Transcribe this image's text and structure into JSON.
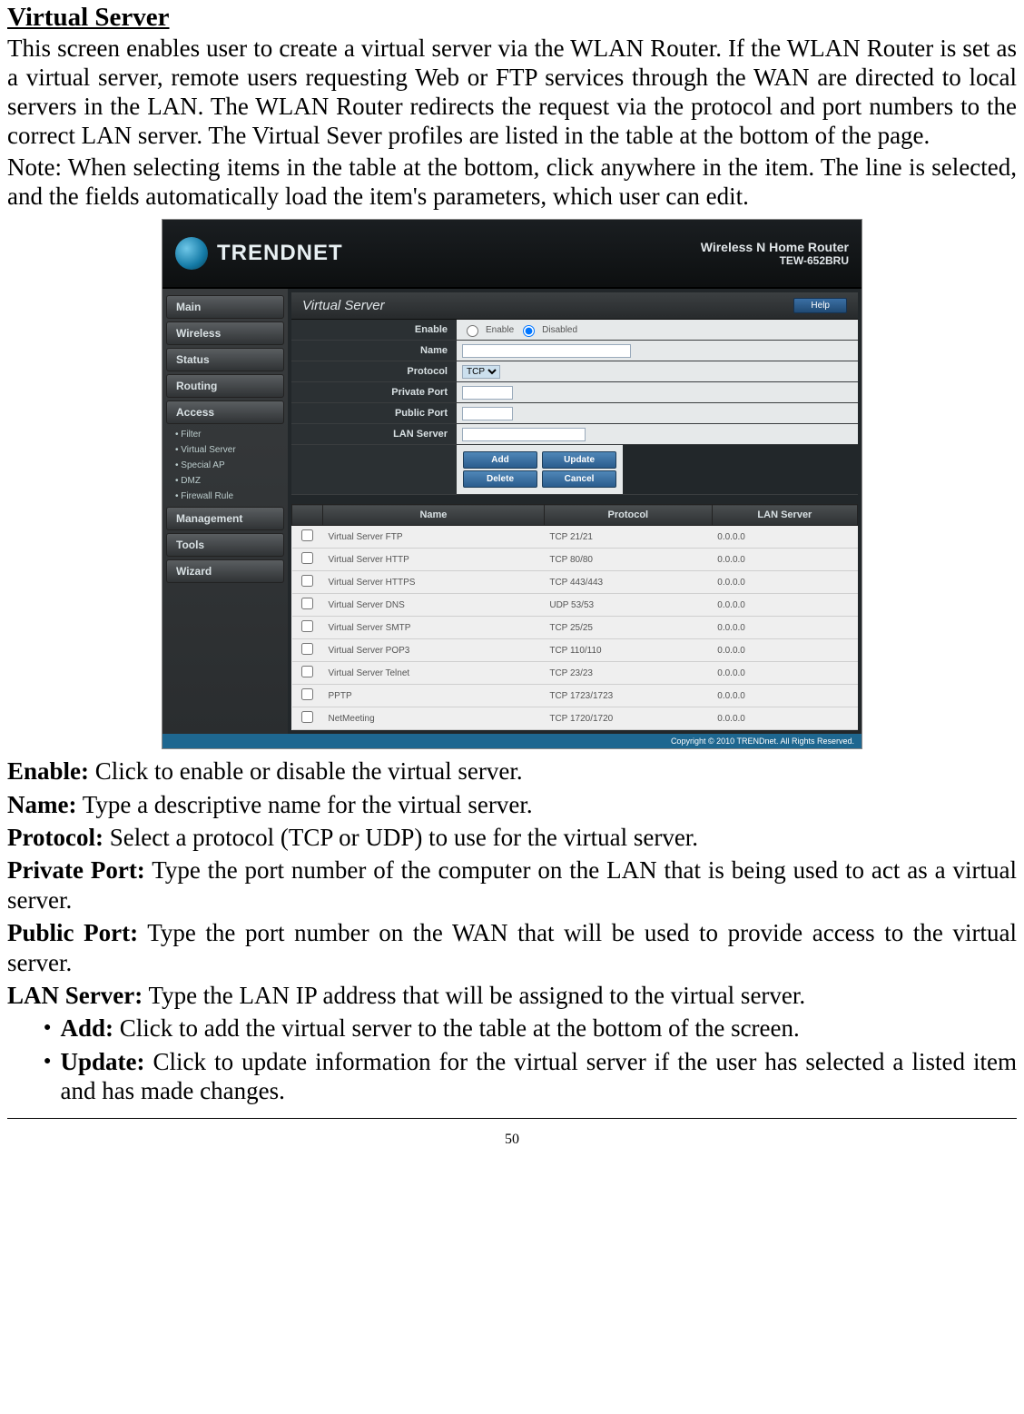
{
  "title": "Virtual Server",
  "p1": "This screen enables user to create a virtual server via the WLAN Router. If the WLAN Router is set as a virtual server, remote users requesting Web or FTP services through the WAN are directed to local servers in the LAN. The WLAN Router redirects the request via the protocol and port numbers to the correct LAN server. The Virtual Sever profiles are listed in the table at the bottom of the page.",
  "p2": "Note: When selecting items in the table at the bottom, click anywhere in the item. The line is selected, and the fields automatically load the item's parameters, which user can edit.",
  "banner": {
    "brand": "TRENDNET",
    "line1": "Wireless N Home Router",
    "line2": "TEW-652BRU"
  },
  "menu": {
    "main": "Main",
    "wireless": "Wireless",
    "status": "Status",
    "routing": "Routing",
    "access": "Access",
    "subs": [
      "Filter",
      "Virtual Server",
      "Special AP",
      "DMZ",
      "Firewall Rule"
    ],
    "management": "Management",
    "tools": "Tools",
    "wizard": "Wizard"
  },
  "panel": {
    "title": "Virtual Server",
    "help": "Help"
  },
  "form": {
    "enable_label": "Enable",
    "enable_opt1": "Enable",
    "enable_opt2": "Disabled",
    "name_label": "Name",
    "protocol_label": "Protocol",
    "protocol_value": "TCP",
    "private_label": "Private Port",
    "public_label": "Public Port",
    "lan_label": "LAN Server"
  },
  "buttons": {
    "add": "Add",
    "update": "Update",
    "delete": "Delete",
    "cancel": "Cancel"
  },
  "table": {
    "headers": {
      "name": "Name",
      "protocol": "Protocol",
      "lan": "LAN Server"
    },
    "rows": [
      {
        "name": "Virtual Server FTP",
        "protocol": "TCP 21/21",
        "lan": "0.0.0.0"
      },
      {
        "name": "Virtual Server HTTP",
        "protocol": "TCP 80/80",
        "lan": "0.0.0.0"
      },
      {
        "name": "Virtual Server HTTPS",
        "protocol": "TCP 443/443",
        "lan": "0.0.0.0"
      },
      {
        "name": "Virtual Server DNS",
        "protocol": "UDP 53/53",
        "lan": "0.0.0.0"
      },
      {
        "name": "Virtual Server SMTP",
        "protocol": "TCP 25/25",
        "lan": "0.0.0.0"
      },
      {
        "name": "Virtual Server POP3",
        "protocol": "TCP 110/110",
        "lan": "0.0.0.0"
      },
      {
        "name": "Virtual Server Telnet",
        "protocol": "TCP 23/23",
        "lan": "0.0.0.0"
      },
      {
        "name": "PPTP",
        "protocol": "TCP 1723/1723",
        "lan": "0.0.0.0"
      },
      {
        "name": "NetMeeting",
        "protocol": "TCP 1720/1720",
        "lan": "0.0.0.0"
      }
    ]
  },
  "copyright": "Copyright © 2010 TRENDnet. All Rights Reserved.",
  "def_enable_h": "Enable:",
  "def_enable_t": " Click to enable or disable the virtual server.",
  "def_name_h": "Name:",
  "def_name_t": " Type a descriptive name for the virtual server.",
  "def_protocol_h": "Protocol:",
  "def_protocol_t": " Select a protocol (TCP or UDP) to use for the virtual server.",
  "def_private_h": "Private Port:",
  "def_private_t": " Type the port number of the computer on the LAN that is being used to act as a virtual server.",
  "def_public_h": "Public Port:",
  "def_public_t": " Type the port number on the WAN that will be used to provide access to the virtual server.",
  "def_lan_h": "LAN Server:",
  "def_lan_t": " Type the LAN IP address that will be assigned to the virtual server.",
  "bul_add_h": "Add:",
  "bul_add_t": " Click to add the virtual server to the table at the bottom of the screen.",
  "bul_update_h": "Update:",
  "bul_update_t": " Click to update information for the virtual server if the user has selected a listed item and has made changes.",
  "page_number": "50"
}
